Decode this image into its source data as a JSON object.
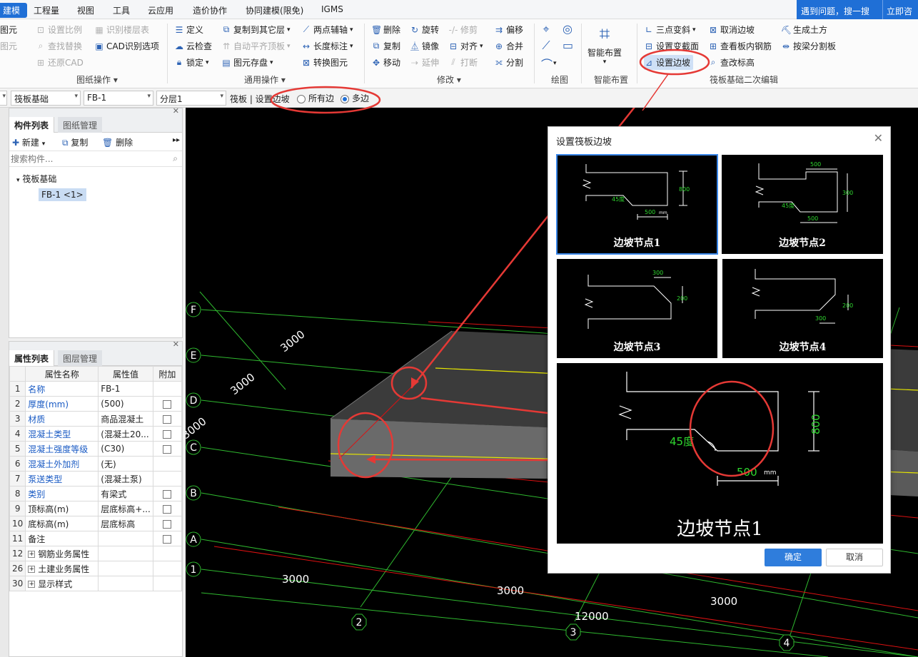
{
  "menu": {
    "items": [
      "建模",
      "工程量",
      "视图",
      "工具",
      "云应用",
      "造价协作",
      "协同建模(限免)",
      "IGMS"
    ],
    "active": "建模"
  },
  "help": {
    "search": "遇到问题，搜一搜",
    "consult": "立即咨"
  },
  "ribbon": {
    "cad_partial": [
      "图元",
      "图元"
    ],
    "cad": [
      "设置比例",
      "识别楼层表",
      "查找替换",
      "CAD识别选项",
      "还原CAD"
    ],
    "general": [
      "定义",
      "复制到其它层",
      "两点辅轴",
      "云检查",
      "自动平齐顶板",
      "长度标注",
      "锁定",
      "图元存盘",
      "转换图元"
    ],
    "modify": [
      "删除",
      "旋转",
      "修剪",
      "偏移",
      "复制",
      "镜像",
      "对齐",
      "合并",
      "移动",
      "延伸",
      "打断",
      "分割"
    ],
    "smart": "智能布置",
    "raft": [
      "三点变斜",
      "取消边坡",
      "生成土方",
      "设置变截面",
      "查看板内钢筋",
      "按梁分割板",
      "设置边坡",
      "查改标高"
    ],
    "groups": [
      "图纸操作",
      "通用操作",
      "修改",
      "绘图",
      "智能布置",
      "筏板基础二次编辑"
    ]
  },
  "toolbar2": {
    "type": "筏板基础",
    "element": "FB-1",
    "layer": "分层1",
    "cmd": "筏板 | 设置边坡",
    "opt_all": "所有边",
    "opt_multi": "多边"
  },
  "component_panel": {
    "tabs": [
      "构件列表",
      "图纸管理"
    ],
    "new": "新建",
    "copy": "复制",
    "delete": "删除",
    "search_placeholder": "搜索构件...",
    "tree_parent": "筏板基础",
    "tree_child": "FB-1 <1>"
  },
  "property_panel": {
    "tabs": [
      "属性列表",
      "图层管理"
    ],
    "headers": [
      "属性名称",
      "属性值",
      "附加"
    ],
    "rows": [
      {
        "n": "1",
        "name": "名称",
        "value": "FB-1",
        "blue": true,
        "chk": false
      },
      {
        "n": "2",
        "name": "厚度(mm)",
        "value": "(500)",
        "blue": true,
        "chk": true
      },
      {
        "n": "3",
        "name": "材质",
        "value": "商品混凝土",
        "blue": true,
        "chk": true
      },
      {
        "n": "4",
        "name": "混凝土类型",
        "value": "(混凝土20...",
        "blue": true,
        "chk": true
      },
      {
        "n": "5",
        "name": "混凝土强度等级",
        "value": "(C30)",
        "blue": true,
        "chk": true
      },
      {
        "n": "6",
        "name": "混凝土外加剂",
        "value": "(无)",
        "blue": true,
        "chk": false
      },
      {
        "n": "7",
        "name": "泵送类型",
        "value": "(混凝土泵)",
        "blue": true,
        "chk": false
      },
      {
        "n": "8",
        "name": "类别",
        "value": "有梁式",
        "blue": true,
        "chk": true
      },
      {
        "n": "9",
        "name": "顶标高(m)",
        "value": "层底标高+...",
        "blue": false,
        "chk": true
      },
      {
        "n": "10",
        "name": "底标高(m)",
        "value": "层底标高",
        "blue": false,
        "chk": true
      },
      {
        "n": "11",
        "name": "备注",
        "value": "",
        "blue": false,
        "chk": true
      },
      {
        "n": "12",
        "name": "钢筋业务属性",
        "value": "",
        "blue": false,
        "chk": false,
        "group": true
      },
      {
        "n": "26",
        "name": "土建业务属性",
        "value": "",
        "blue": false,
        "chk": false,
        "group": true
      },
      {
        "n": "30",
        "name": "显示样式",
        "value": "",
        "blue": false,
        "chk": false,
        "group": true
      }
    ]
  },
  "viewport": {
    "axis_letters": [
      "F",
      "E",
      "D",
      "C",
      "B",
      "A",
      "1"
    ],
    "axis_numbers": [
      "2",
      "3",
      "4"
    ],
    "dims": [
      "3000",
      "3000",
      "3000",
      "3000",
      "3000",
      "3000",
      "12000"
    ]
  },
  "dialog": {
    "title": "设置筏板边坡",
    "nodes": [
      "边坡节点1",
      "边坡节点2",
      "边坡节点3",
      "边坡节点4"
    ],
    "preview_label": "边坡节点1",
    "marks": {
      "d500": "500",
      "d800": "800",
      "d300": "300",
      "d200": "200",
      "deg": "45度",
      "deg_short": "45度",
      "unit": "mm"
    },
    "ok": "确定",
    "cancel": "取消"
  },
  "colors": {
    "accent": "#1f6fd6",
    "annotation": "#e53935",
    "grid": "#2fb82f",
    "redline": "#d11",
    "axis_yellow": "#e6e600"
  }
}
